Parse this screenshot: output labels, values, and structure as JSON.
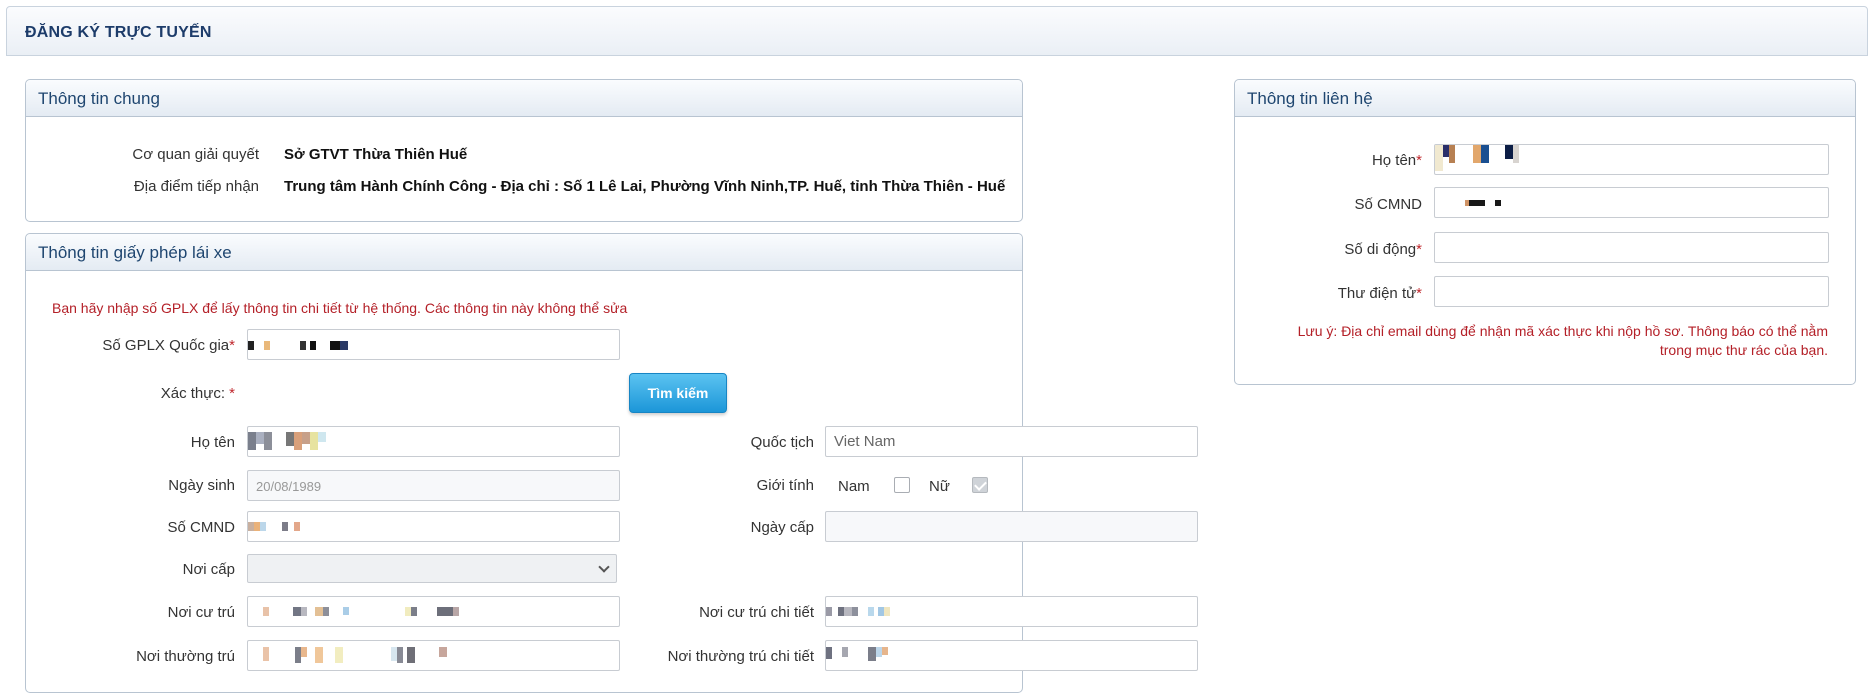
{
  "header": {
    "title": "ĐĂNG KÝ TRỰC TUYẾN"
  },
  "general": {
    "title": "Thông tin chung",
    "agency_label": "Cơ quan giải quyết",
    "agency_value": "Sở GTVT Thừa Thiên Huế",
    "location_label": "Địa điểm tiếp nhận",
    "location_value": "Trung tâm Hành Chính Công - Địa chỉ : Số 1 Lê Lai, Phường Vĩnh Ninh,TP. Huế, tỉnh Thừa Thiên - Huế"
  },
  "license": {
    "title": "Thông tin giấy phép lái xe",
    "note": "Bạn hãy nhập số GPLX để lấy thông tin chi tiết từ hệ thống. Các thông tin này không thể sửa",
    "gplx_label": "Số GPLX Quốc gia",
    "verify_label": "Xác thực:",
    "search_button": "Tìm kiếm",
    "name_label": "Họ tên",
    "nationality_label": "Quốc tịch",
    "nationality_value": "Viet Nam",
    "dob_label": "Ngày sinh",
    "dob_value": "20/08/1989",
    "gender_label": "Giới tính",
    "gender_male": "Nam",
    "gender_female": "Nữ",
    "gender_male_checked": false,
    "gender_female_checked": true,
    "idcard_label": "Số CMND",
    "issue_date_label": "Ngày cấp",
    "issue_place_label": "Nơi cấp",
    "residence_label": "Nơi cư trú",
    "residence_detail_label": "Nơi cư trú chi tiết",
    "permanent_label": "Nơi thường trú",
    "permanent_detail_label": "Nơi thường trú chi tiết"
  },
  "contact": {
    "title": "Thông tin liên hệ",
    "name_label": "Họ tên",
    "idcard_label": "Số CMND",
    "phone_label": "Số di động",
    "email_label": "Thư điện tử",
    "note_line1": "Lưu ý: Địa chỉ email dùng để nhận mã xác thực khi nộp hồ sơ. Thông báo có thể nằm",
    "note_line2": "trong mục thư rác của bạn."
  },
  "required_mark": "*",
  "colors": {
    "accent": "#1c96d8",
    "heading": "#1f4670",
    "required": "#c0272d"
  }
}
